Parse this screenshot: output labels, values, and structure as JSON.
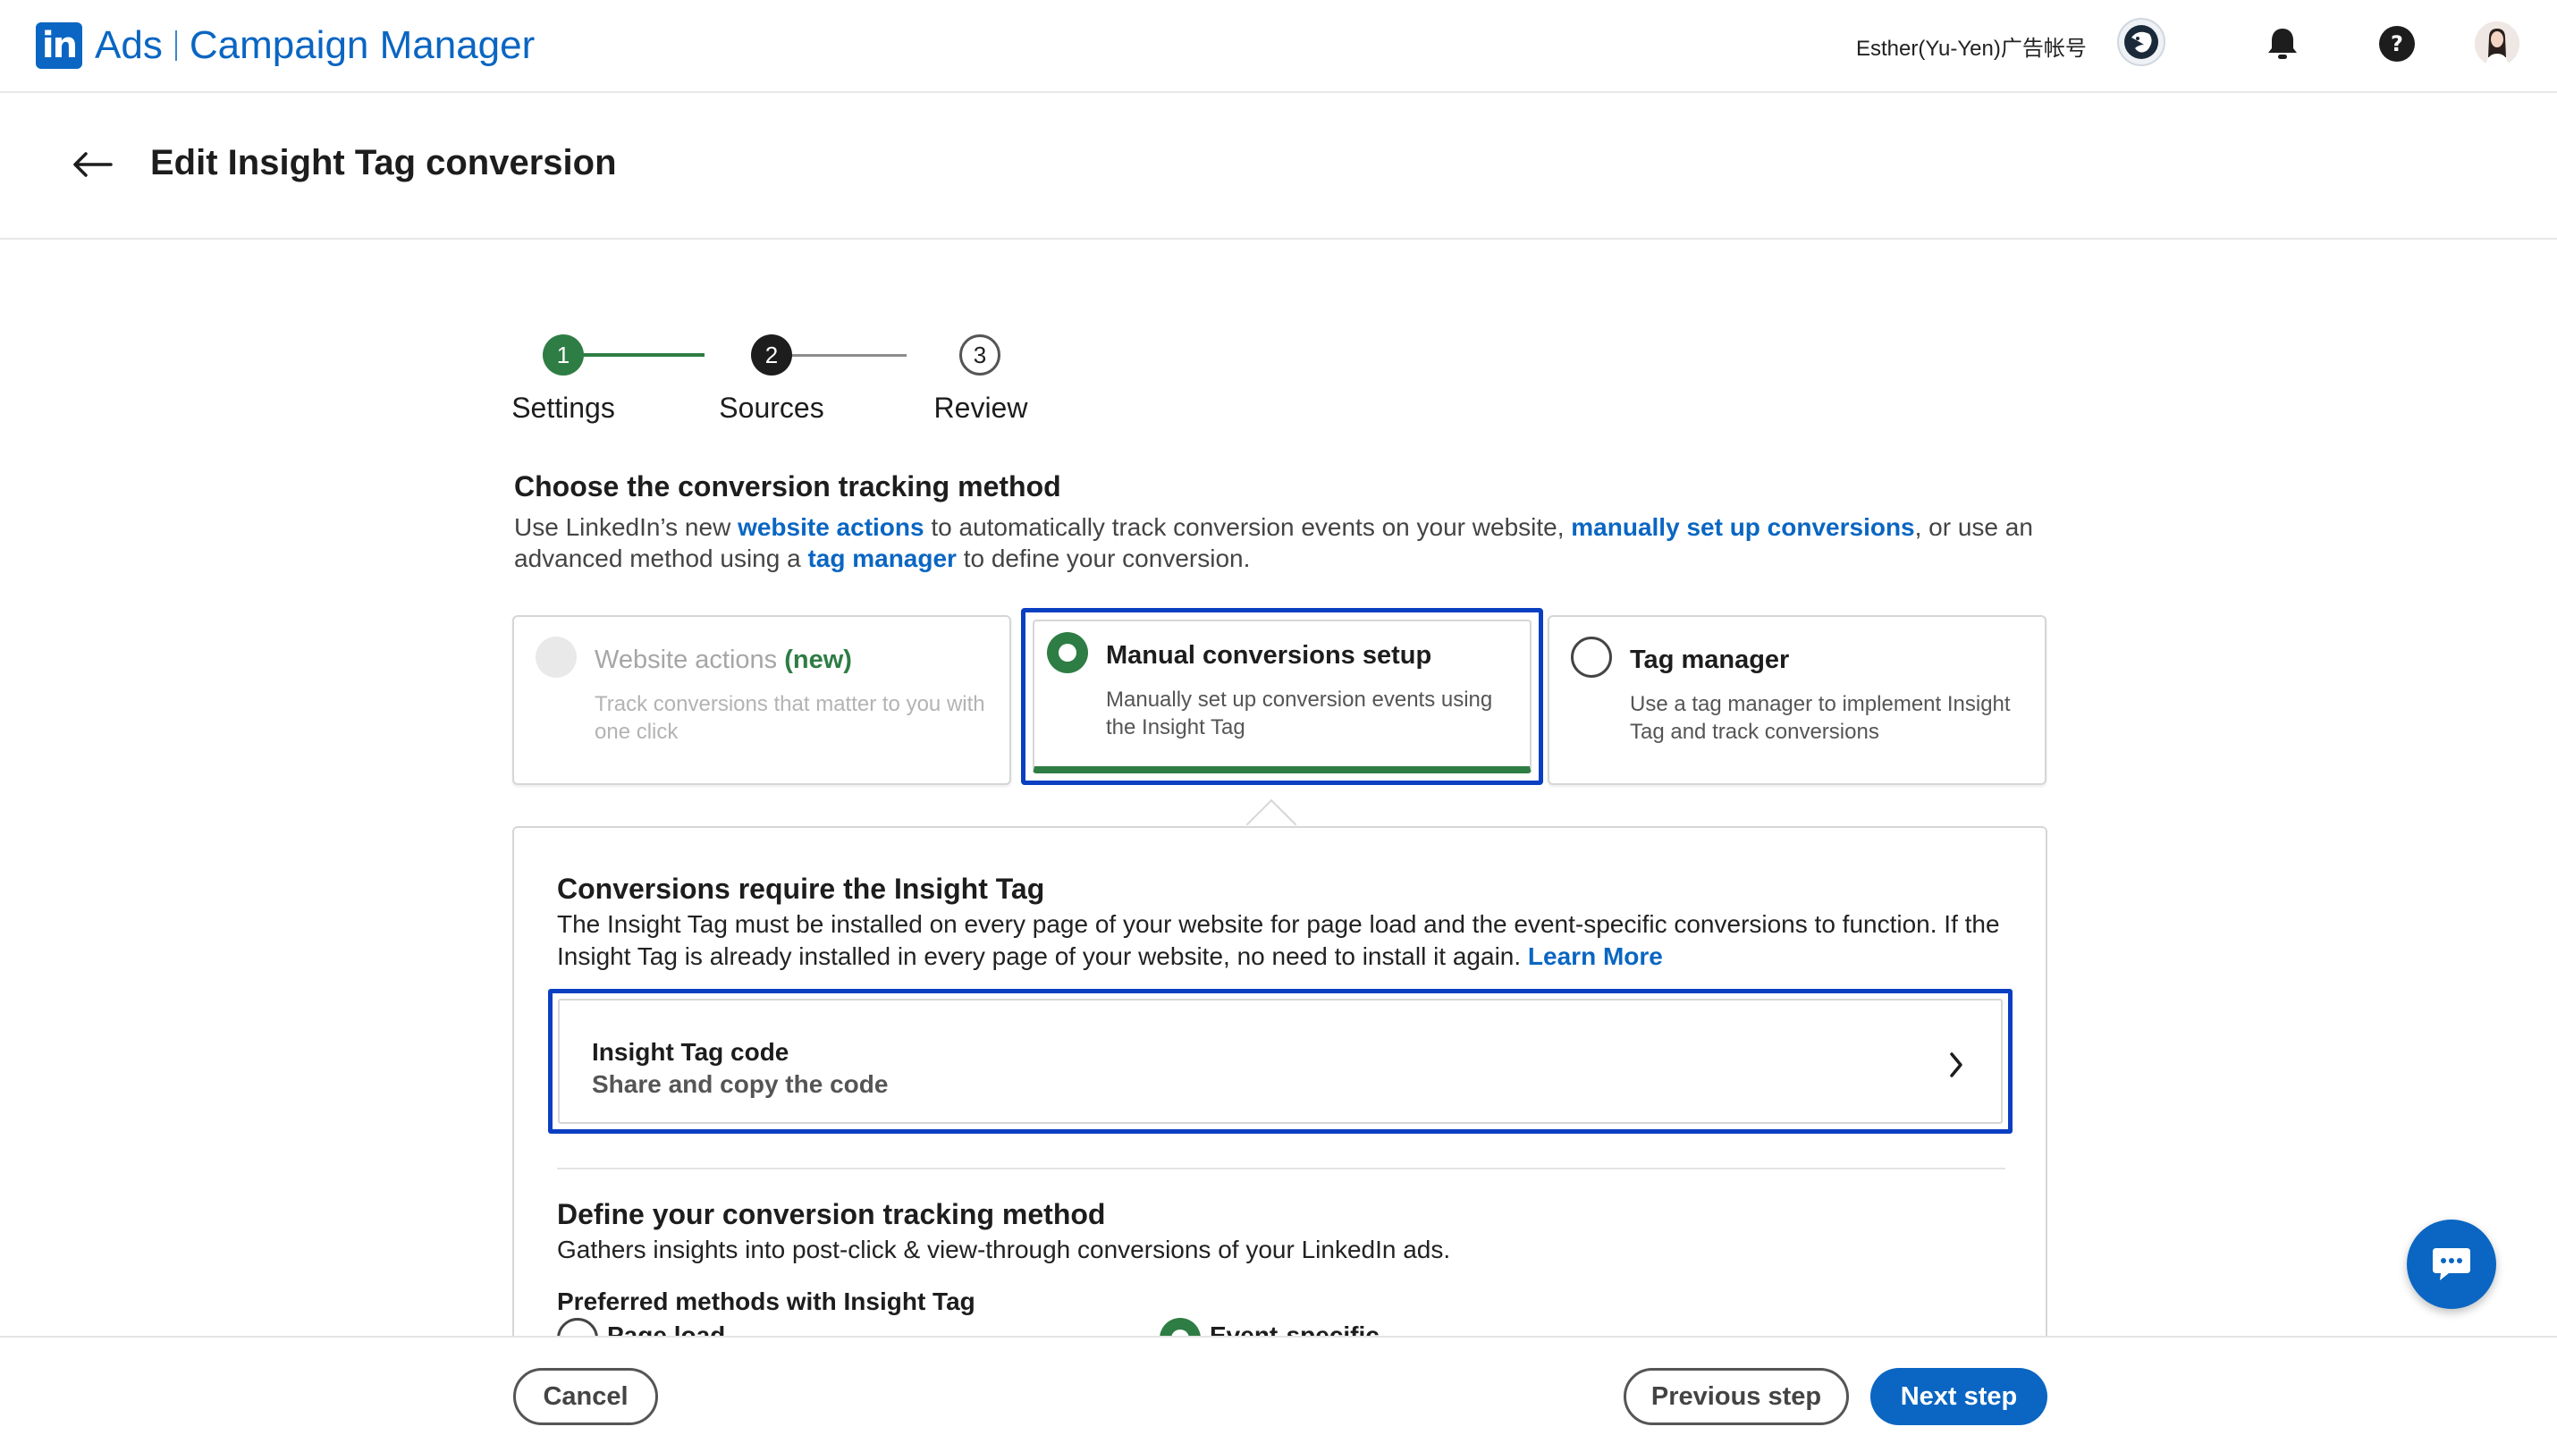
{
  "brand": {
    "logo": "in",
    "product": "Ads",
    "name": "Campaign Manager"
  },
  "account": {
    "name": "Esther(Yu-Yen)广告帐号"
  },
  "icons": {
    "account_avatar": "account-avatar-icon",
    "bell": "bell-icon",
    "help": "help-icon",
    "user": "user-avatar-icon",
    "back": "back-arrow-icon",
    "chevron": "chevron-right-icon",
    "chat": "chat-icon"
  },
  "page": {
    "title": "Edit Insight Tag conversion"
  },
  "stepper": {
    "steps": [
      {
        "number": "1",
        "label": "Settings",
        "state": "done"
      },
      {
        "number": "2",
        "label": "Sources",
        "state": "current"
      },
      {
        "number": "3",
        "label": "Review",
        "state": "todo"
      }
    ]
  },
  "method": {
    "title": "Choose the conversion tracking method",
    "desc": {
      "p1": "Use LinkedIn’s new ",
      "link1": "website actions",
      "p2": " to automatically track conversion events on your website, ",
      "link2": "manually set up conversions",
      "p3": ", or use an advanced method using a ",
      "link3": "tag manager",
      "p4": " to define your conversion."
    },
    "options": [
      {
        "title": "Website actions",
        "badge": "(new)",
        "desc": "Track conversions that matter to you with one click",
        "state": "disabled"
      },
      {
        "title": "Manual conversions setup",
        "desc": "Manually set up conversion events using the Insight Tag",
        "state": "selected"
      },
      {
        "title": "Tag manager",
        "desc": "Use a tag manager to implement Insight Tag and track conversions",
        "state": "unselected"
      }
    ]
  },
  "insight": {
    "title": "Conversions require the Insight Tag",
    "desc": "The Insight Tag must be installed on every page of your website for page load and the event-specific conversions to function. If the Insight Tag is already installed in every page of your website, no need to install it again. ",
    "learn_more": "Learn More",
    "code_row": {
      "title": "Insight Tag code",
      "subtitle": "Share and copy the code"
    }
  },
  "define": {
    "title": "Define your conversion tracking method",
    "desc": "Gathers insights into post-click & view-through conversions of your LinkedIn ads.",
    "preferred_title": "Preferred methods with Insight Tag",
    "options": [
      {
        "label": "Page load",
        "selected": false
      },
      {
        "label": "Event-specific",
        "selected": true
      }
    ]
  },
  "footer": {
    "cancel": "Cancel",
    "previous": "Previous step",
    "next": "Next step"
  },
  "colors": {
    "brand": "#0a66c2",
    "success": "#2e7d44",
    "focus": "#0a3fc2"
  }
}
